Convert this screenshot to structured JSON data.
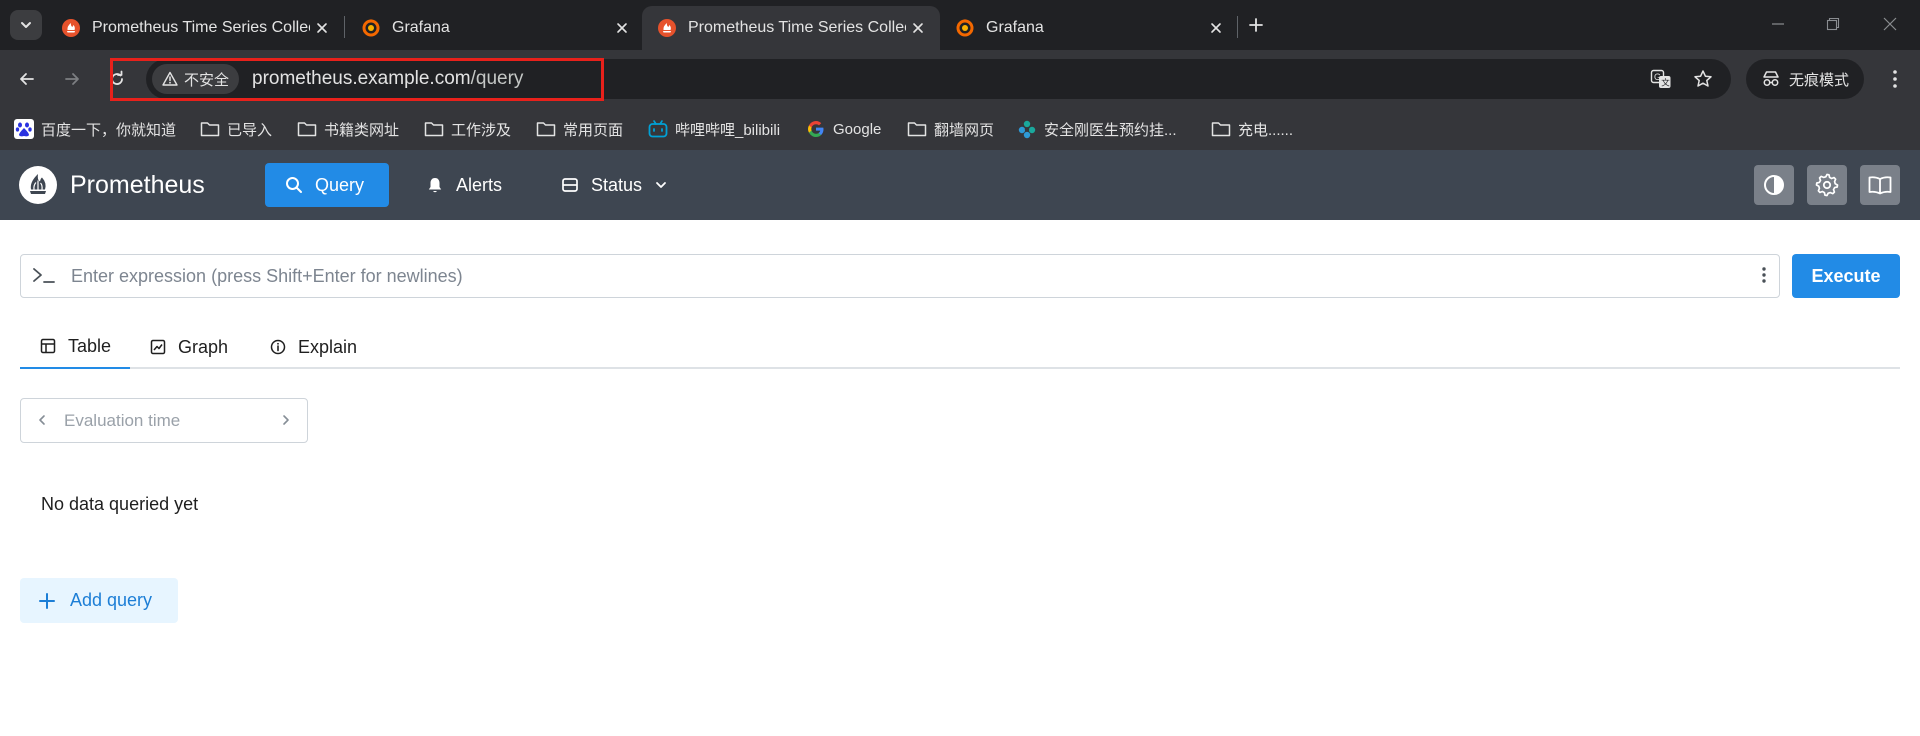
{
  "browser": {
    "tabs": [
      {
        "title": "Prometheus Time Series Collection and Processing Server",
        "favicon": "prometheus-icon",
        "active": false
      },
      {
        "title": "Grafana",
        "favicon": "grafana-icon",
        "active": false
      },
      {
        "title": "Prometheus Time Series Collection and Processing Server",
        "favicon": "prometheus-icon",
        "active": true
      },
      {
        "title": "Grafana",
        "favicon": "grafana-icon",
        "active": false
      }
    ],
    "security_label": "不安全",
    "url_host": "prometheus.example.com",
    "url_path": "/query",
    "incognito_label": "无痕模式",
    "bookmarks": [
      {
        "label": "百度一下，你就知道",
        "icon": "baidu-icon"
      },
      {
        "label": "已导入",
        "icon": "folder-icon"
      },
      {
        "label": "书籍类网址",
        "icon": "folder-icon"
      },
      {
        "label": "工作涉及",
        "icon": "folder-icon"
      },
      {
        "label": "常用页面",
        "icon": "folder-icon"
      },
      {
        "label": "哔哩哔哩_bilibili",
        "icon": "bilibili-icon"
      },
      {
        "label": "Google",
        "icon": "google-icon"
      },
      {
        "label": "翻墙网页",
        "icon": "folder-icon"
      },
      {
        "label": "安全刚医生预约挂...",
        "icon": "hospital-icon"
      },
      {
        "label": "充电......",
        "icon": "folder-icon"
      }
    ]
  },
  "app": {
    "name": "Prometheus",
    "nav": [
      {
        "label": "Query",
        "icon": "search-icon",
        "active": true
      },
      {
        "label": "Alerts",
        "icon": "bell-icon",
        "active": false
      },
      {
        "label": "Status",
        "icon": "server-icon",
        "active": false
      }
    ],
    "accent_color": "#228be6"
  },
  "query": {
    "placeholder": "Enter expression (press Shift+Enter for newlines)",
    "execute_label": "Execute",
    "tabs": [
      {
        "label": "Table",
        "icon": "table-icon",
        "active": true
      },
      {
        "label": "Graph",
        "icon": "chart-icon",
        "active": false
      },
      {
        "label": "Explain",
        "icon": "info-icon",
        "active": false
      }
    ],
    "evaluation_placeholder": "Evaluation time",
    "empty_message": "No data queried yet",
    "add_query_label": "Add query"
  }
}
